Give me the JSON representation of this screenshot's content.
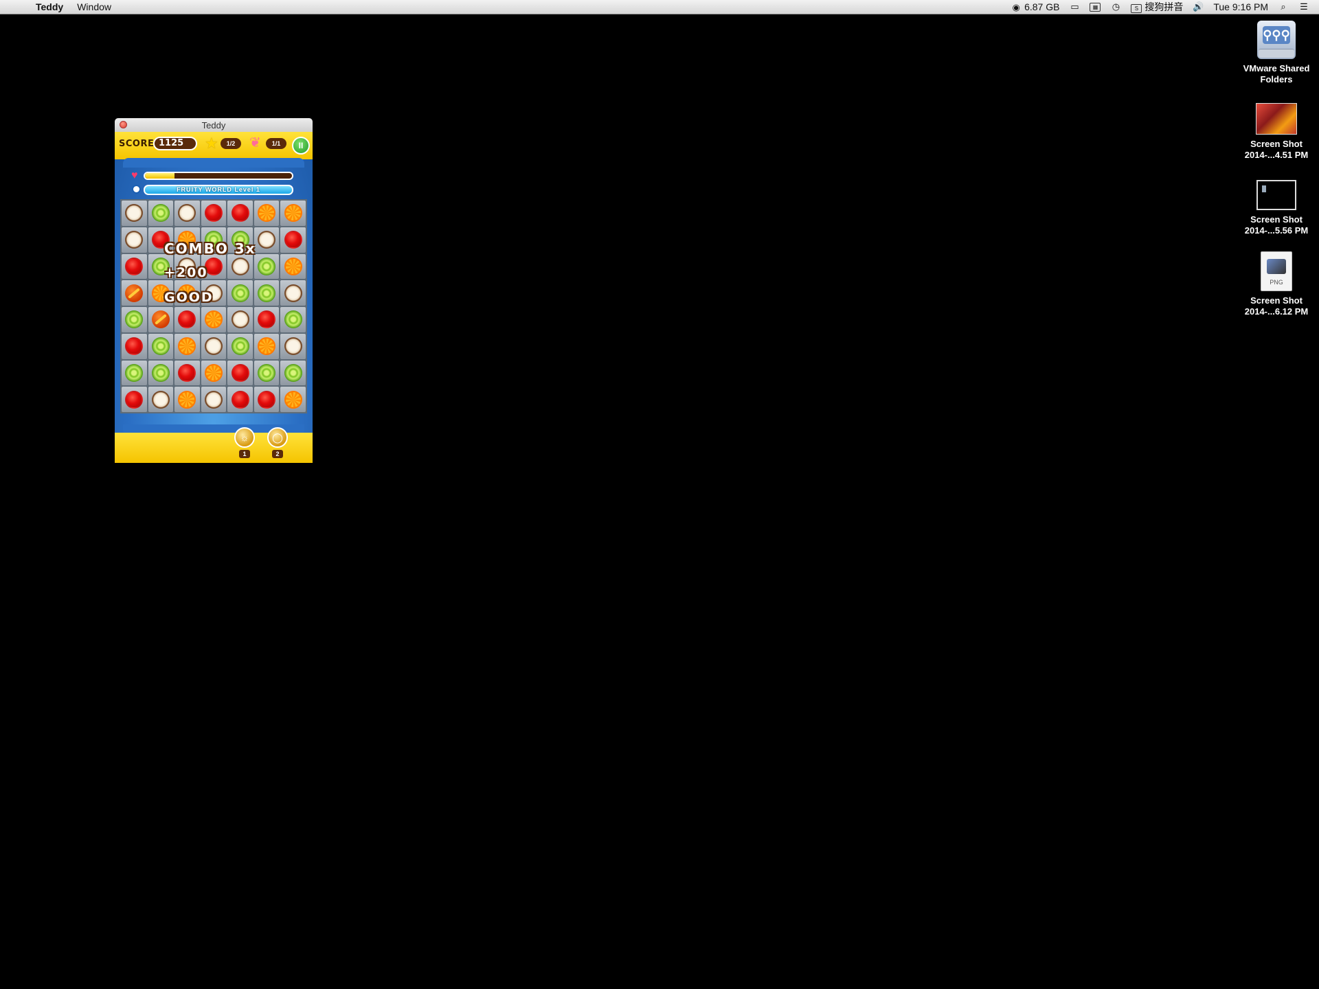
{
  "menubar": {
    "app_name": "Teddy",
    "menus": [
      "Window"
    ],
    "memory": "6.87 GB",
    "input_method": "搜狗拼音",
    "clock": "Tue 9:16 PM"
  },
  "desktop": {
    "icons": [
      {
        "label_line1": "VMware Shared",
        "label_line2": "Folders",
        "icon": "shared-folder-icon"
      },
      {
        "label_line1": "Screen Shot",
        "label_line2": "2014-...4.51 PM",
        "icon": "screenshot-thumbnail-icon"
      },
      {
        "label_line1": "Screen Shot",
        "label_line2": "2014-...5.56 PM",
        "icon": "screenshot-thumbnail-icon"
      },
      {
        "label_line1": "Screen Shot",
        "label_line2": "2014-...6.12 PM",
        "icon": "png-file-icon",
        "badge": "PNG"
      }
    ]
  },
  "window": {
    "title": "Teddy"
  },
  "game": {
    "score_label": "SCORE",
    "score": "1125",
    "stars": "1/2",
    "bows": "1/1",
    "pause_symbol": "II",
    "life_fraction": 0.2,
    "level_label": "FRUITY WORLD Level 1",
    "combo_text": "COMBO 3x",
    "points_text": "+200",
    "praise_text": "GOOD",
    "board": [
      [
        "coconut",
        "lime",
        "coconut",
        "cherry",
        "cherry",
        "orange",
        "orange"
      ],
      [
        "coconut",
        "cherry",
        "orange",
        "lime",
        "lime",
        "coconut",
        "cherry"
      ],
      [
        "cherry",
        "lime",
        "coconut",
        "cherry",
        "coconut",
        "lime",
        "orange"
      ],
      [
        "bomb",
        "orange",
        "orange",
        "coconut",
        "lime",
        "lime",
        "coconut"
      ],
      [
        "lime",
        "bomb",
        "cherry",
        "orange",
        "coconut",
        "cherry",
        "lime"
      ],
      [
        "cherry",
        "lime",
        "orange",
        "coconut",
        "lime",
        "orange",
        "coconut"
      ],
      [
        "lime",
        "lime",
        "cherry",
        "orange",
        "cherry",
        "lime",
        "lime"
      ],
      [
        "cherry",
        "coconut",
        "orange",
        "coconut",
        "cherry",
        "cherry",
        "orange"
      ]
    ],
    "boosters": [
      {
        "count": "1",
        "icon": "booster-coin-icon"
      },
      {
        "count": "2",
        "icon": "booster-ring-icon"
      }
    ]
  }
}
